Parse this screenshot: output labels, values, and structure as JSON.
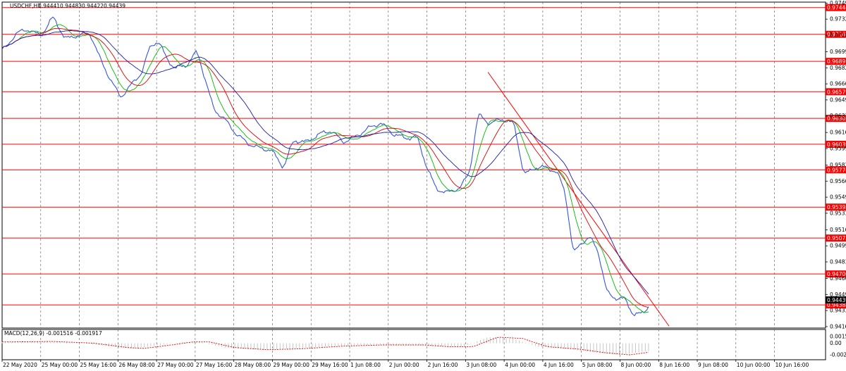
{
  "chart_data": {
    "type": "line",
    "symbol": "USDCHF,H1",
    "ohlc": [
      "0.94441",
      "0.94483",
      "0.94422",
      "0.94439"
    ],
    "y_axis": {
      "min": 0.9415,
      "max": 0.975,
      "ticks": [
        "0.97490",
        "0.97325",
        "0.97160",
        "0.96990",
        "0.96825",
        "0.96660",
        "0.96495",
        "0.96330",
        "0.96160",
        "0.95995",
        "0.95825",
        "0.95660",
        "0.95495",
        "0.95330",
        "0.95160",
        "0.94995",
        "0.94830",
        "0.94660",
        "0.94495",
        "0.94330",
        "0.94165"
      ]
    },
    "x_axis": {
      "labels": [
        "22 May 2020",
        "25 May 00:00",
        "25 May 16:00",
        "26 May 08:00",
        "27 May 00:00",
        "27 May 16:00",
        "28 May 08:00",
        "29 May 00:00",
        "29 May 16:00",
        "1 Jun 08:00",
        "2 Jun 00:00",
        "2 Jun 16:00",
        "3 Jun 08:00",
        "4 Jun 00:00",
        "4 Jun 16:00",
        "5 Jun 08:00",
        "8 Jun 00:00",
        "8 Jun 16:00",
        "9 Jun 08:00",
        "10 Jun 00:00",
        "10 Jun 16:00"
      ]
    },
    "price_levels": [
      {
        "label": "0.97444",
        "value": 0.97444
      },
      {
        "label": "0.97169",
        "value": 0.97169
      },
      {
        "label": "0.96891",
        "value": 0.96891
      },
      {
        "label": "0.96579",
        "value": 0.96579
      },
      {
        "label": "0.96305",
        "value": 0.96305
      },
      {
        "label": "0.96039",
        "value": 0.96039
      },
      {
        "label": "0.95776",
        "value": 0.95776
      },
      {
        "label": "0.95393",
        "value": 0.95393
      },
      {
        "label": "0.95075",
        "value": 0.95075
      },
      {
        "label": "0.94706",
        "value": 0.94706
      },
      {
        "label": "0.94388",
        "value": 0.94388
      }
    ],
    "current_price": {
      "label": "0.94439",
      "value": 0.94439
    },
    "trendline": {
      "from": [
        0.59,
        0.9678
      ],
      "to": [
        0.81,
        0.9417
      ]
    },
    "price_series": {
      "anchors": [
        [
          0.0,
          0.97
        ],
        [
          0.015,
          0.9718
        ],
        [
          0.03,
          0.9722
        ],
        [
          0.045,
          0.9715
        ],
        [
          0.06,
          0.9735
        ],
        [
          0.075,
          0.9712
        ],
        [
          0.09,
          0.9716
        ],
        [
          0.105,
          0.9718
        ],
        [
          0.118,
          0.969
        ],
        [
          0.13,
          0.967
        ],
        [
          0.142,
          0.9652
        ],
        [
          0.155,
          0.9665
        ],
        [
          0.168,
          0.9678
        ],
        [
          0.178,
          0.9705
        ],
        [
          0.188,
          0.971
        ],
        [
          0.198,
          0.9692
        ],
        [
          0.208,
          0.9682
        ],
        [
          0.222,
          0.9685
        ],
        [
          0.235,
          0.97
        ],
        [
          0.245,
          0.967
        ],
        [
          0.255,
          0.964
        ],
        [
          0.268,
          0.963
        ],
        [
          0.282,
          0.9615
        ],
        [
          0.296,
          0.9605
        ],
        [
          0.31,
          0.96
        ],
        [
          0.325,
          0.9598
        ],
        [
          0.34,
          0.958
        ],
        [
          0.352,
          0.9608
        ],
        [
          0.368,
          0.9606
        ],
        [
          0.382,
          0.9614
        ],
        [
          0.398,
          0.9618
        ],
        [
          0.412,
          0.9606
        ],
        [
          0.428,
          0.9612
        ],
        [
          0.442,
          0.962
        ],
        [
          0.458,
          0.9626
        ],
        [
          0.472,
          0.9615
        ],
        [
          0.488,
          0.961
        ],
        [
          0.502,
          0.9612
        ],
        [
          0.512,
          0.9585
        ],
        [
          0.525,
          0.9558
        ],
        [
          0.54,
          0.9554
        ],
        [
          0.555,
          0.956
        ],
        [
          0.566,
          0.9575
        ],
        [
          0.576,
          0.9635
        ],
        [
          0.59,
          0.9625
        ],
        [
          0.605,
          0.963
        ],
        [
          0.62,
          0.9625
        ],
        [
          0.632,
          0.9572
        ],
        [
          0.645,
          0.958
        ],
        [
          0.66,
          0.958
        ],
        [
          0.672,
          0.9575
        ],
        [
          0.682,
          0.9555
        ],
        [
          0.692,
          0.949
        ],
        [
          0.7,
          0.9502
        ],
        [
          0.712,
          0.9508
        ],
        [
          0.722,
          0.9495
        ],
        [
          0.732,
          0.9452
        ],
        [
          0.745,
          0.9445
        ],
        [
          0.755,
          0.9445
        ],
        [
          0.765,
          0.9428
        ],
        [
          0.775,
          0.943
        ],
        [
          0.785,
          0.9439
        ]
      ],
      "series": [
        {
          "color": "#3355dd",
          "period": 3
        },
        {
          "color": "#00bb00",
          "period": 12
        },
        {
          "color": "#dd0000",
          "period": 22
        },
        {
          "color": "#1a1aaa",
          "period": 38
        }
      ]
    },
    "macd": {
      "label": "MACD(12,26,9) -0.001516 -0.001917",
      "y_ticks": [
        "0.001547",
        "0.00",
        "-0.002714"
      ],
      "min": -0.0035,
      "max": 0.0022,
      "histogram_color": "#c0c0c0",
      "signal_color": "#dd0000",
      "anchors": [
        [
          0.0,
          0.0003
        ],
        [
          0.05,
          0.0004
        ],
        [
          0.1,
          0.0
        ],
        [
          0.14,
          -0.001
        ],
        [
          0.16,
          -0.0012
        ],
        [
          0.19,
          -0.0005
        ],
        [
          0.22,
          0.0003
        ],
        [
          0.24,
          0.0003
        ],
        [
          0.27,
          -0.001
        ],
        [
          0.31,
          -0.0015
        ],
        [
          0.35,
          -0.0013
        ],
        [
          0.4,
          -0.0007
        ],
        [
          0.45,
          -0.0004
        ],
        [
          0.5,
          -0.0004
        ],
        [
          0.53,
          -0.0008
        ],
        [
          0.56,
          -0.0008
        ],
        [
          0.59,
          0.0014
        ],
        [
          0.62,
          0.0011
        ],
        [
          0.65,
          -0.0008
        ],
        [
          0.69,
          -0.0014
        ],
        [
          0.72,
          -0.0022
        ],
        [
          0.75,
          -0.0027
        ],
        [
          0.785,
          -0.0018
        ]
      ]
    },
    "grid": true,
    "colors": {
      "background": "#ffffff",
      "grid": "#555555",
      "level_line": "#ff0000",
      "level_tag": "#ff0000"
    }
  }
}
